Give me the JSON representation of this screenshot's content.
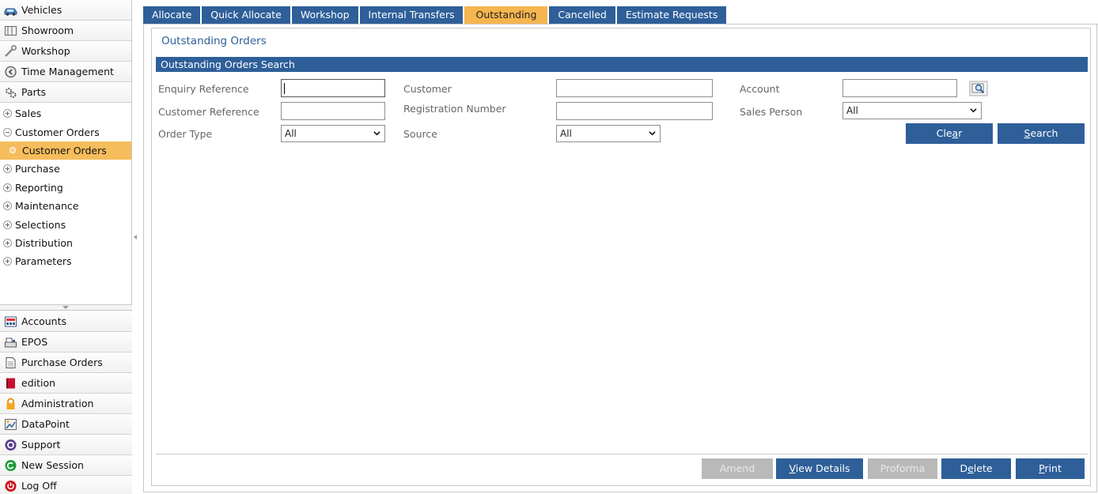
{
  "sidebar": {
    "top_modules": [
      {
        "label": "Vehicles",
        "icon": "vehicle-icon"
      },
      {
        "label": "Showroom",
        "icon": "showroom-icon"
      },
      {
        "label": "Workshop",
        "icon": "wrench-icon"
      },
      {
        "label": "Time Management",
        "icon": "clock-icon"
      },
      {
        "label": "Parts",
        "icon": "gear-icon"
      }
    ],
    "tree": [
      {
        "label": "Sales",
        "state": "collapsed"
      },
      {
        "label": "Customer Orders",
        "state": "expanded"
      },
      {
        "label": "Customer Orders",
        "state": "selected-child"
      },
      {
        "label": "Purchase",
        "state": "collapsed"
      },
      {
        "label": "Reporting",
        "state": "collapsed"
      },
      {
        "label": "Maintenance",
        "state": "collapsed"
      },
      {
        "label": "Selections",
        "state": "collapsed"
      },
      {
        "label": "Distribution",
        "state": "collapsed"
      },
      {
        "label": "Parameters",
        "state": "collapsed"
      }
    ],
    "bottom_modules": [
      {
        "label": "Accounts",
        "icon": "calculator-icon"
      },
      {
        "label": "EPOS",
        "icon": "till-icon"
      },
      {
        "label": "Purchase Orders",
        "icon": "document-icon"
      },
      {
        "label": "edition",
        "icon": "book-icon"
      },
      {
        "label": "Administration",
        "icon": "lock-icon"
      },
      {
        "label": "DataPoint",
        "icon": "datapoint-icon"
      },
      {
        "label": "Support",
        "icon": "support-icon"
      },
      {
        "label": "New Session",
        "icon": "new-session-icon"
      },
      {
        "label": "Log Off",
        "icon": "power-icon"
      }
    ]
  },
  "tabs": [
    {
      "label": "Allocate",
      "active": false
    },
    {
      "label": "Quick Allocate",
      "active": false
    },
    {
      "label": "Workshop",
      "active": false
    },
    {
      "label": "Internal Transfers",
      "active": false
    },
    {
      "label": "Outstanding",
      "active": true
    },
    {
      "label": "Cancelled",
      "active": false
    },
    {
      "label": "Estimate Requests",
      "active": false
    }
  ],
  "page": {
    "title": "Outstanding Orders",
    "section_header": "Outstanding Orders Search"
  },
  "form": {
    "enquiry_reference": {
      "label": "Enquiry Reference",
      "value": ""
    },
    "customer_reference": {
      "label": "Customer Reference",
      "value": ""
    },
    "order_type": {
      "label": "Order Type",
      "value": "All"
    },
    "customer": {
      "label": "Customer",
      "value": ""
    },
    "registration_number": {
      "label": "Registration Number",
      "value": ""
    },
    "source": {
      "label": "Source",
      "value": "All"
    },
    "account": {
      "label": "Account",
      "value": ""
    },
    "sales_person": {
      "label": "Sales Person",
      "value": "All"
    }
  },
  "buttons": {
    "clear": {
      "pre": "Cle",
      "u": "a",
      "post": "r"
    },
    "search": {
      "pre": "",
      "u": "S",
      "post": "earch"
    },
    "amend": {
      "label": "Amend",
      "enabled": false
    },
    "view_details": {
      "pre": "",
      "u": "V",
      "post": "iew Details",
      "enabled": true
    },
    "proforma": {
      "label": "Proforma",
      "enabled": false
    },
    "delete": {
      "pre": "D",
      "u": "e",
      "post": "lete",
      "enabled": true
    },
    "print": {
      "pre": "",
      "u": "P",
      "post": "rint",
      "enabled": true
    }
  },
  "colors": {
    "accent_blue": "#2e5f99",
    "active_tab": "#f6b54e",
    "selected_tree_item": "#f6bd5c",
    "disabled_button": "#b9b9b9"
  }
}
